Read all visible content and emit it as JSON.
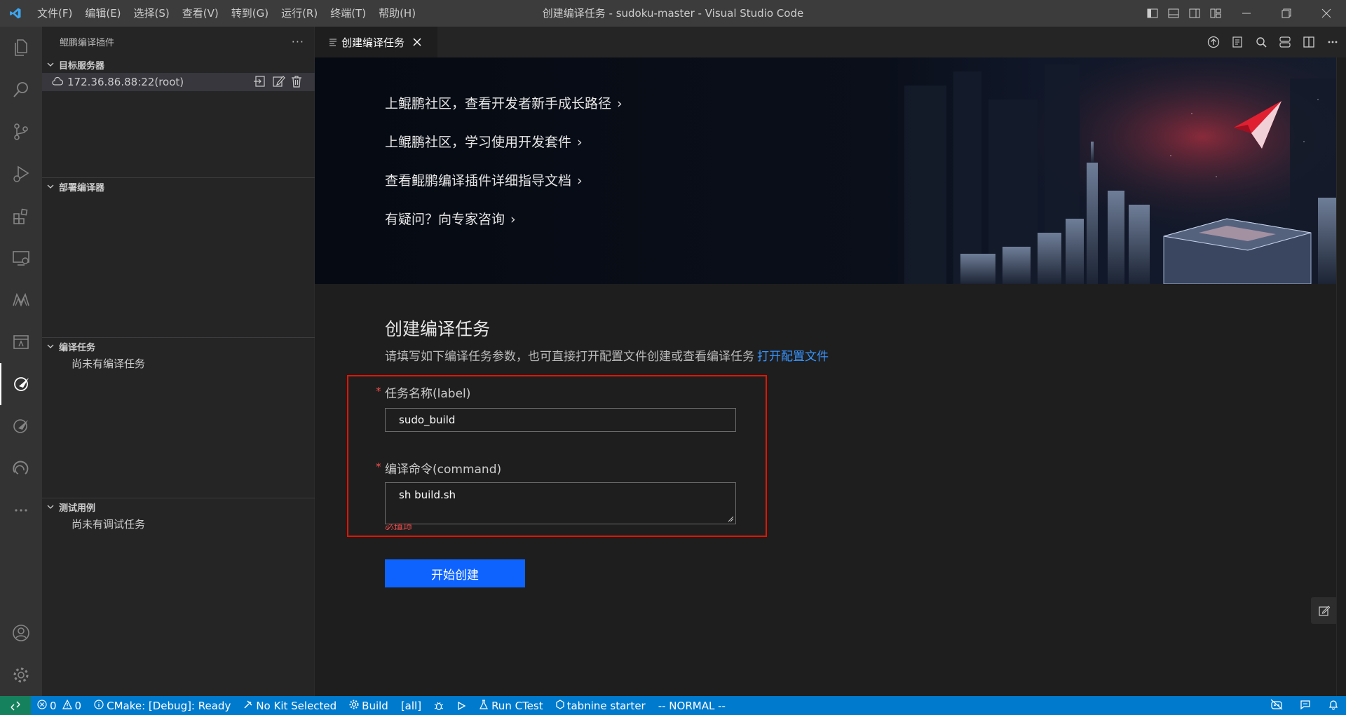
{
  "window": {
    "title": "创建编译任务 - sudoku-master - Visual Studio Code",
    "menu": [
      "文件(F)",
      "编辑(E)",
      "选择(S)",
      "查看(V)",
      "转到(G)",
      "运行(R)",
      "终端(T)",
      "帮助(H)"
    ]
  },
  "sidebar": {
    "header": "鲲鹏编译插件",
    "sections": {
      "servers": {
        "title": "目标服务器",
        "item": "172.36.86.88:22(root)"
      },
      "deploy": {
        "title": "部署编译器"
      },
      "tasks": {
        "title": "编译任务",
        "empty": "尚未有编译任务"
      },
      "tests": {
        "title": "测试用例",
        "empty": "尚未有调试任务"
      }
    }
  },
  "tab": {
    "label": "创建编译任务"
  },
  "banner": {
    "links": [
      "上鲲鹏社区，查看开发者新手成长路径",
      "上鲲鹏社区，学习使用开发套件",
      "查看鲲鹏编译插件详细指导文档",
      "有疑问？向专家咨询"
    ]
  },
  "form": {
    "title": "创建编译任务",
    "description": "请填写如下编译任务参数，也可直接打开配置文件创建或查看编译任务",
    "open_config_link": "打开配置文件",
    "label_field": {
      "label": "任务名称(label)",
      "value": "sudo_build"
    },
    "command_field": {
      "label": "编译命令(command)",
      "value": "sh build.sh"
    },
    "required_hint": "必填项",
    "submit": "开始创建"
  },
  "statusbar": {
    "errors": "0",
    "warnings": "0",
    "cmake": "CMake: [Debug]: Ready",
    "kit": "No Kit Selected",
    "build": "Build",
    "target": "[all]",
    "ctest": "Run CTest",
    "tabnine": "tabnine starter",
    "mode": "-- NORMAL --"
  },
  "colors": {
    "accent": "#007acc",
    "button": "#0e63ff",
    "highlight_box": "#e51400",
    "link": "#3794ff"
  }
}
